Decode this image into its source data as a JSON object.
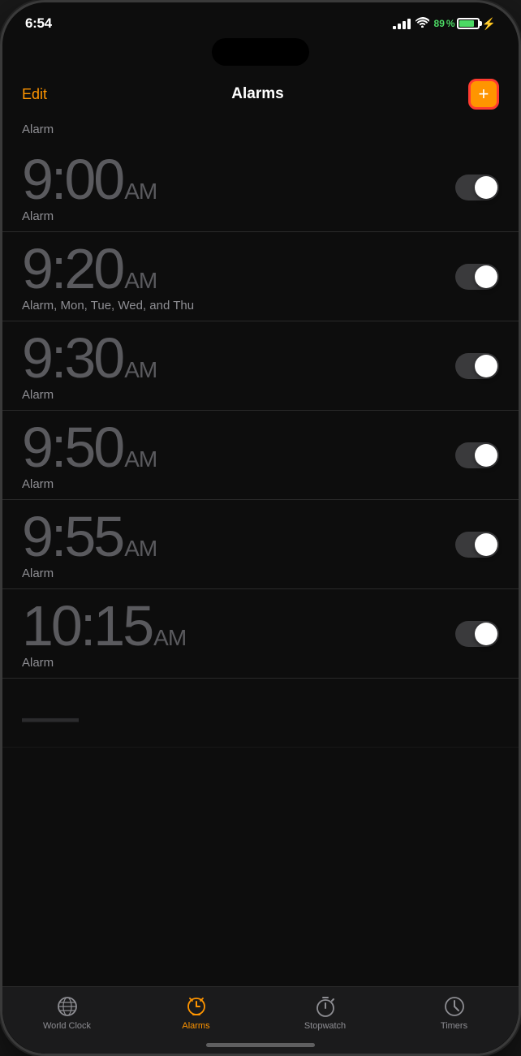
{
  "statusBar": {
    "time": "6:54",
    "battery": "89",
    "batteryColor": "#4cd964"
  },
  "header": {
    "editLabel": "Edit",
    "title": "Alarms",
    "addLabel": "+"
  },
  "alarms": [
    {
      "id": 1,
      "sectionLabel": "Alarm",
      "time": "9:00",
      "ampm": "AM",
      "label": "Alarm",
      "enabled": false
    },
    {
      "id": 2,
      "time": "9:20",
      "ampm": "AM",
      "label": "Alarm, Mon, Tue, Wed, and Thu",
      "enabled": false
    },
    {
      "id": 3,
      "time": "9:30",
      "ampm": "AM",
      "label": "Alarm",
      "enabled": false
    },
    {
      "id": 4,
      "time": "9:50",
      "ampm": "AM",
      "label": "Alarm",
      "enabled": false
    },
    {
      "id": 5,
      "time": "9:55",
      "ampm": "AM",
      "label": "Alarm",
      "enabled": false
    },
    {
      "id": 6,
      "time": "10:15",
      "ampm": "AM",
      "label": "Alarm",
      "enabled": false
    }
  ],
  "tabBar": {
    "items": [
      {
        "id": "world-clock",
        "label": "World Clock",
        "active": false
      },
      {
        "id": "alarms",
        "label": "Alarms",
        "active": true
      },
      {
        "id": "stopwatch",
        "label": "Stopwatch",
        "active": false
      },
      {
        "id": "timers",
        "label": "Timers",
        "active": false
      }
    ]
  }
}
